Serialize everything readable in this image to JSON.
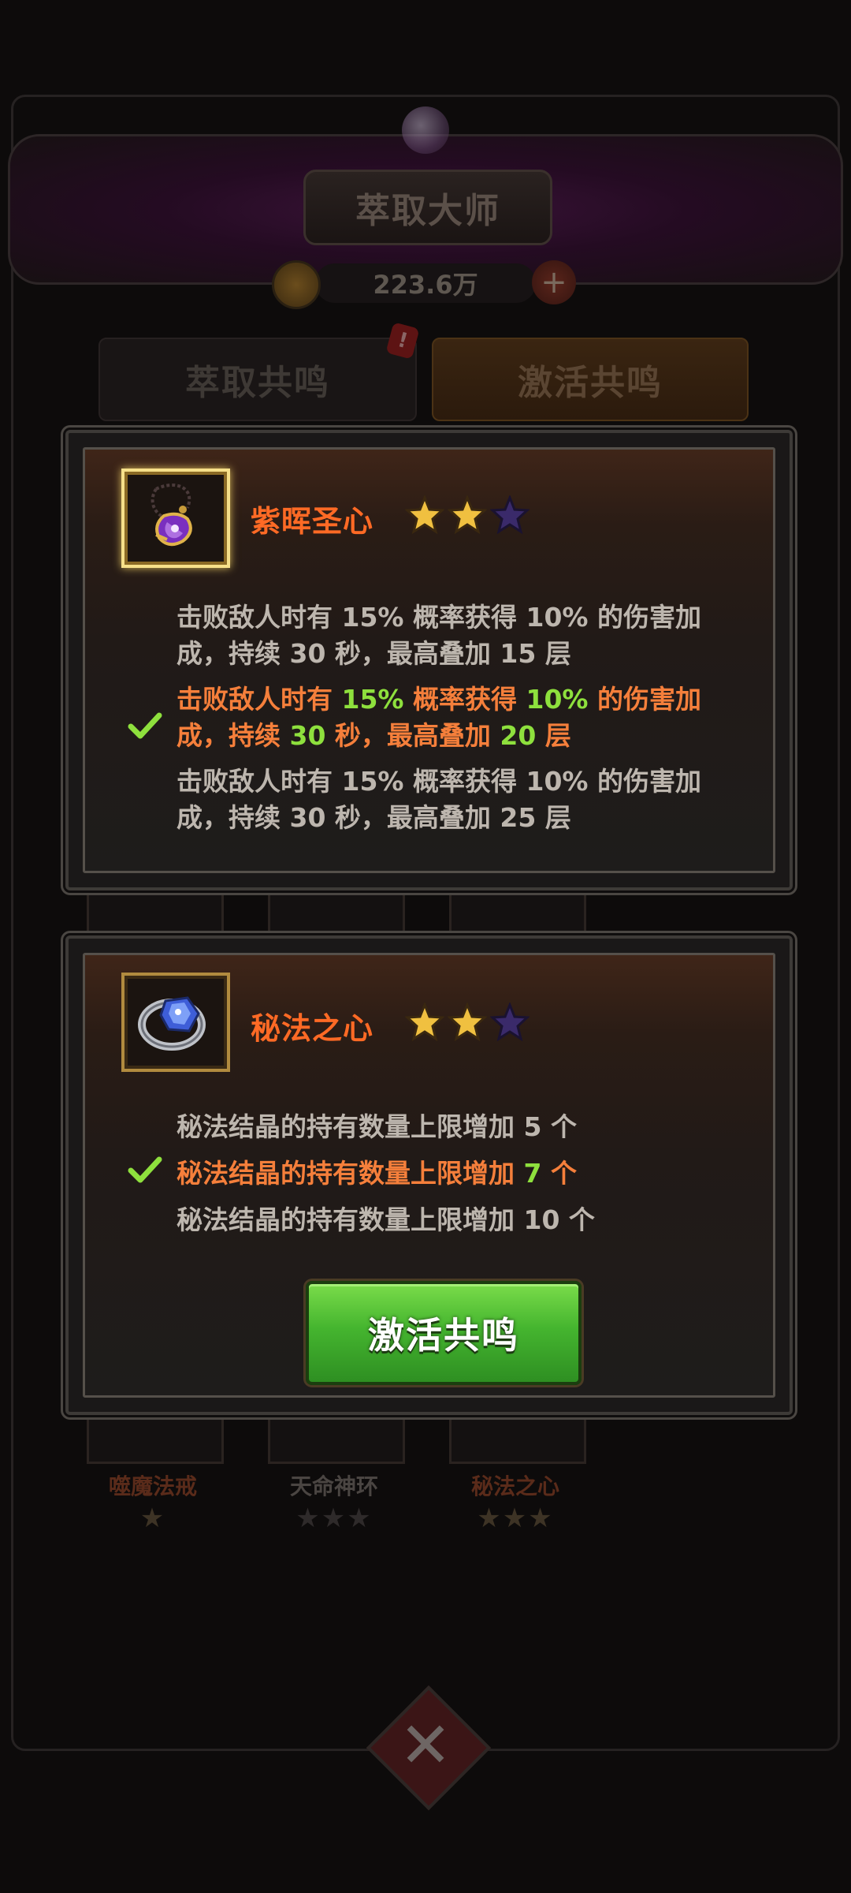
{
  "background": {
    "title": "萃取大师",
    "currency_amount": "223.6万",
    "tabs": [
      {
        "label": "萃取共鸣"
      },
      {
        "label": "激活共鸣"
      }
    ],
    "badge": "!",
    "items": [
      {
        "name": "噬魔法戒"
      },
      {
        "name": "天命神环"
      },
      {
        "name": "秘法之心"
      }
    ]
  },
  "card1": {
    "item_name": "紫晖圣心",
    "item_icon": "amulet-icon",
    "stars_filled": 2,
    "stars_total": 3,
    "effects": [
      {
        "pre": "击败敌人时有 ",
        "v1": "15%",
        "mid1": " 概率获得 ",
        "v2": "10%",
        "mid2": " 的伤害加成，持续 ",
        "v3": "30",
        "mid3": " 秒，最高叠加 ",
        "v4": "15",
        "post": " 层",
        "active": false
      },
      {
        "pre": "击败敌人时有 ",
        "v1": "15%",
        "mid1": " 概率获得 ",
        "v2": "10%",
        "mid2": " 的伤害加成，持续 ",
        "v3": "30",
        "mid3": " 秒，最高叠加 ",
        "v4": "20",
        "post": " 层",
        "active": true
      },
      {
        "pre": "击败敌人时有 ",
        "v1": "15%",
        "mid1": " 概率获得 ",
        "v2": "10%",
        "mid2": " 的伤害加成，持续 ",
        "v3": "30",
        "mid3": " 秒，最高叠加 ",
        "v4": "25",
        "post": " 层",
        "active": false
      }
    ]
  },
  "card2": {
    "item_name": "秘法之心",
    "item_icon": "ring-icon",
    "stars_filled": 2,
    "stars_total": 3,
    "effects": [
      {
        "pre": "秘法结晶的持有数量上限增加 ",
        "v": "5",
        "post": " 个",
        "active": false
      },
      {
        "pre": "秘法结晶的持有数量上限增加 ",
        "v": "7",
        "post": " 个",
        "active": true
      },
      {
        "pre": "秘法结晶的持有数量上限增加 ",
        "v": "10",
        "post": " 个",
        "active": false
      }
    ],
    "button_label": "激活共鸣"
  },
  "colors": {
    "title_orange": "#ff6a25",
    "active_text": "#f57f3b",
    "highlight_green": "#8ee03d",
    "button_green": "#45b52f"
  }
}
